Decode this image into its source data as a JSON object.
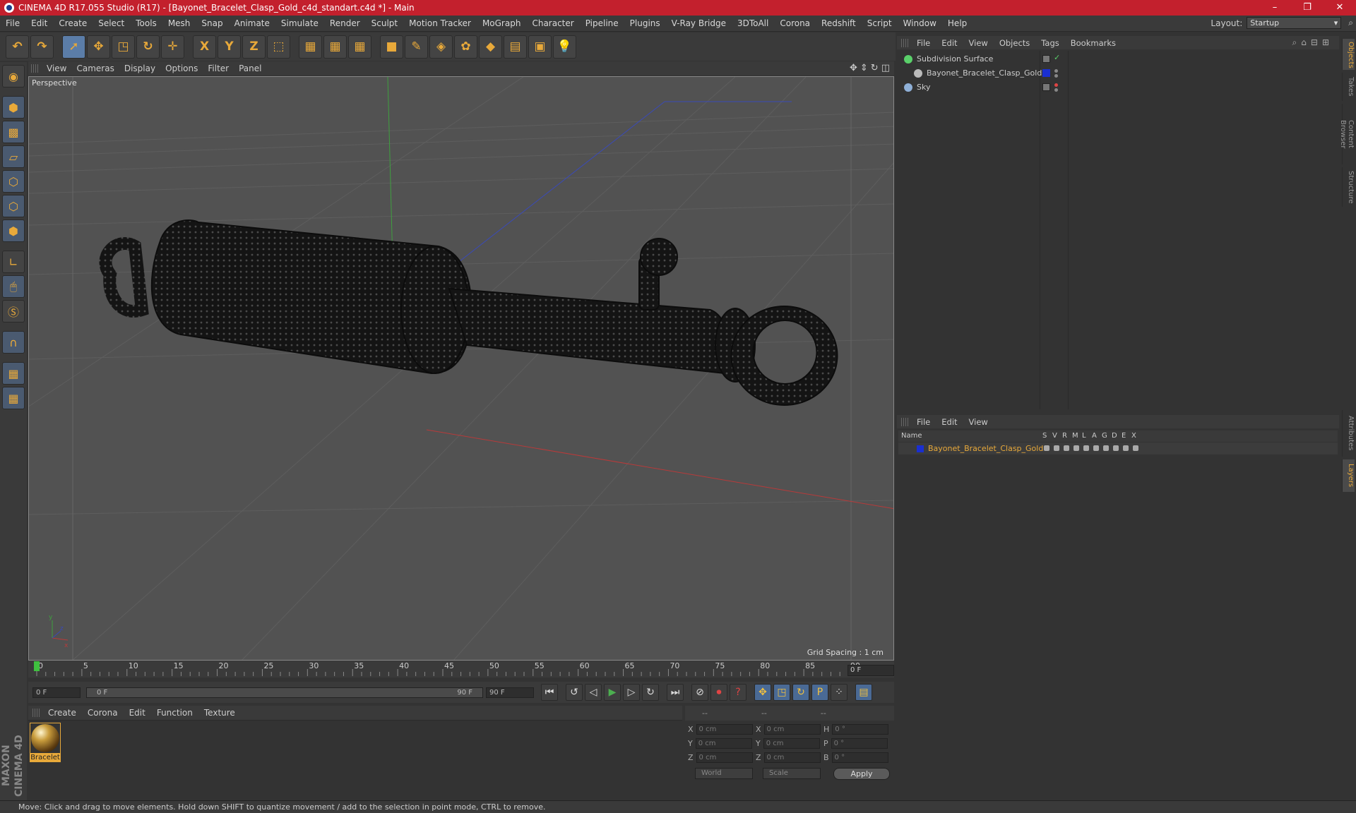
{
  "titlebar": {
    "title": "CINEMA 4D R17.055 Studio (R17) - [Bayonet_Bracelet_Clasp_Gold_c4d_standart.c4d *] - Main",
    "min": "–",
    "max": "❐",
    "close": "✕"
  },
  "menubar": {
    "items": [
      "File",
      "Edit",
      "Create",
      "Select",
      "Tools",
      "Mesh",
      "Snap",
      "Animate",
      "Simulate",
      "Render",
      "Sculpt",
      "Motion Tracker",
      "MoGraph",
      "Character",
      "Pipeline",
      "Plugins",
      "V-Ray Bridge",
      "3DToAll",
      "Corona",
      "Redshift",
      "Script",
      "Window",
      "Help"
    ],
    "layout_label": "Layout:",
    "layout_value": "Startup"
  },
  "toolbar": {
    "buttons": [
      {
        "name": "undo-icon",
        "glyph": "↶"
      },
      {
        "name": "redo-icon",
        "glyph": "↷"
      },
      {
        "name": "select-icon",
        "glyph": "➚"
      },
      {
        "name": "move-icon",
        "glyph": "✥"
      },
      {
        "name": "scale-icon",
        "glyph": "◳"
      },
      {
        "name": "rotate-icon",
        "glyph": "↻"
      },
      {
        "name": "last-tool-icon",
        "glyph": "✛"
      },
      {
        "name": "x-axis-icon",
        "glyph": "X"
      },
      {
        "name": "y-axis-icon",
        "glyph": "Y"
      },
      {
        "name": "z-axis-icon",
        "glyph": "Z"
      },
      {
        "name": "coord-system-icon",
        "glyph": "⬚"
      },
      {
        "name": "render-view-icon",
        "glyph": "▦"
      },
      {
        "name": "render-picture-viewer-icon",
        "glyph": "▦"
      },
      {
        "name": "render-settings-icon",
        "glyph": "▦"
      },
      {
        "name": "cube-icon",
        "glyph": "■"
      },
      {
        "name": "pen-icon",
        "glyph": "✎"
      },
      {
        "name": "subdivision-icon",
        "glyph": "◈"
      },
      {
        "name": "array-icon",
        "glyph": "✿"
      },
      {
        "name": "deformer-icon",
        "glyph": "◆"
      },
      {
        "name": "floor-icon",
        "glyph": "▤"
      },
      {
        "name": "camera-icon",
        "glyph": "▣"
      },
      {
        "name": "light-icon",
        "glyph": "💡"
      }
    ]
  },
  "viewport": {
    "menu": [
      "View",
      "Cameras",
      "Display",
      "Options",
      "Filter",
      "Panel"
    ],
    "label": "Perspective",
    "grid_spacing": "Grid Spacing : 1 cm"
  },
  "timeline": {
    "ticks": [
      "0",
      "5",
      "10",
      "15",
      "20",
      "25",
      "30",
      "35",
      "40",
      "45",
      "50",
      "55",
      "60",
      "65",
      "70",
      "75",
      "80",
      "85",
      "90"
    ],
    "current_frame": "0 F"
  },
  "playback": {
    "start": "0 F",
    "range_start": "0 F",
    "range_end": "90 F",
    "end": "90 F"
  },
  "material_manager": {
    "menu": [
      "Create",
      "Corona",
      "Edit",
      "Function",
      "Texture"
    ],
    "material_name": "Bracelet"
  },
  "coordinates": {
    "headers": [
      "--",
      "--",
      "--"
    ],
    "rows": [
      {
        "a": "X",
        "av": "0 cm",
        "b": "X",
        "bv": "0 cm",
        "c": "H",
        "cv": "0 °"
      },
      {
        "a": "Y",
        "av": "0 cm",
        "b": "Y",
        "bv": "0 cm",
        "c": "P",
        "cv": "0 °"
      },
      {
        "a": "Z",
        "av": "0 cm",
        "b": "Z",
        "bv": "0 cm",
        "c": "B",
        "cv": "0 °"
      }
    ],
    "mode1": "World",
    "mode2": "Scale",
    "apply": "Apply"
  },
  "object_manager": {
    "menu": [
      "File",
      "Edit",
      "View",
      "Objects",
      "Tags",
      "Bookmarks"
    ],
    "objects": [
      {
        "name": "Subdivision Surface",
        "indent": 0,
        "icon_color": "#5ad06a"
      },
      {
        "name": "Bayonet_Bracelet_Clasp_Gold",
        "indent": 1,
        "icon_color": "#bbbbbb"
      },
      {
        "name": "Sky",
        "indent": 0,
        "icon_color": "#8fb0d8"
      }
    ]
  },
  "layer_manager": {
    "menu": [
      "File",
      "Edit",
      "View"
    ],
    "columns": [
      "Name",
      "S",
      "V",
      "R",
      "M",
      "L",
      "A",
      "G",
      "D",
      "E",
      "X"
    ],
    "layer_name": "Bayonet_Bracelet_Clasp_Gold",
    "layer_color": "#1a2fd0"
  },
  "side_tabs": [
    "Objects",
    "Takes",
    "Content Browser",
    "Structure",
    "Attributes",
    "Layers"
  ],
  "status": "Move: Click and drag to move elements. Hold down SHIFT to quantize movement / add to the selection in point mode, CTRL to remove.",
  "logo": "MAXON CINEMA 4D"
}
